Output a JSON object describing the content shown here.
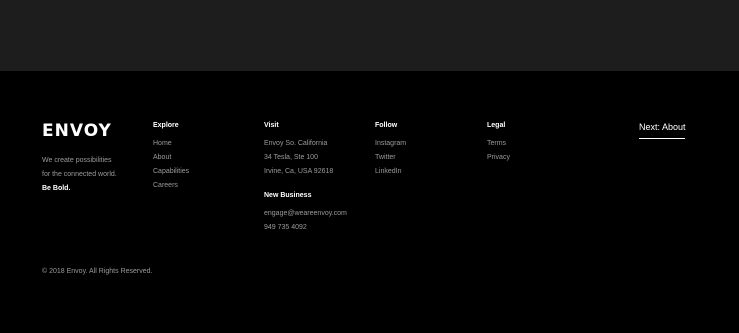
{
  "brand": {
    "logo": "ENVOY",
    "tagline_line1": "We create possibilities",
    "tagline_line2": "for the connected world.",
    "tagline_bold": "Be Bold."
  },
  "explore": {
    "title": "Explore",
    "items": [
      "Home",
      "About",
      "Capabilities",
      "Careers"
    ]
  },
  "visit": {
    "title": "Visit",
    "lines": [
      "Envoy So. California",
      "34 Tesla, Ste 100",
      "Irvine, Ca, USA 92618"
    ],
    "new_business_title": "New Business",
    "email": "engage@weareenvoy.com",
    "phone": "949 735 4092"
  },
  "follow": {
    "title": "Follow",
    "items": [
      "Instagram",
      "Twitter",
      "LinkedIn"
    ]
  },
  "legal": {
    "title": "Legal",
    "items": [
      "Terms",
      "Privacy"
    ]
  },
  "next_link": "Next: About",
  "copyright": "© 2018 Envoy. All Rights Reserved."
}
